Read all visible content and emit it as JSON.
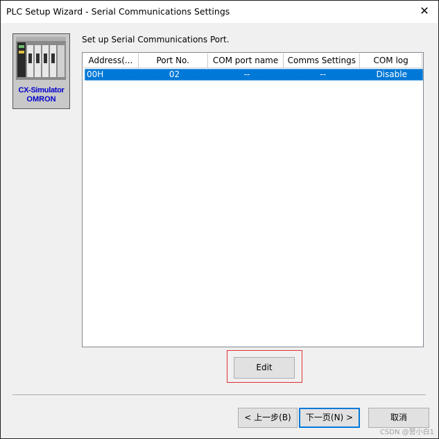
{
  "window": {
    "title": "PLC Setup Wizard - Serial Communications Settings",
    "close_glyph": "✕"
  },
  "logo": {
    "line1": "CX-Simulator",
    "line2": "OMRON"
  },
  "instruction": "Set up Serial Communications Port.",
  "list": {
    "columns": [
      "Address(...",
      "Port No.",
      "COM port name",
      "Comms Settings",
      "COM log"
    ],
    "rows": [
      {
        "address": "00H",
        "port_no": "02",
        "com_port_name": "--",
        "comms_settings": "--",
        "com_log": "Disable",
        "selected": true
      }
    ]
  },
  "buttons": {
    "edit": "Edit",
    "back": "< 上一步(B)",
    "next": "下一页(N) >",
    "cancel": "取消"
  },
  "watermark": "CSDN @营小白1"
}
